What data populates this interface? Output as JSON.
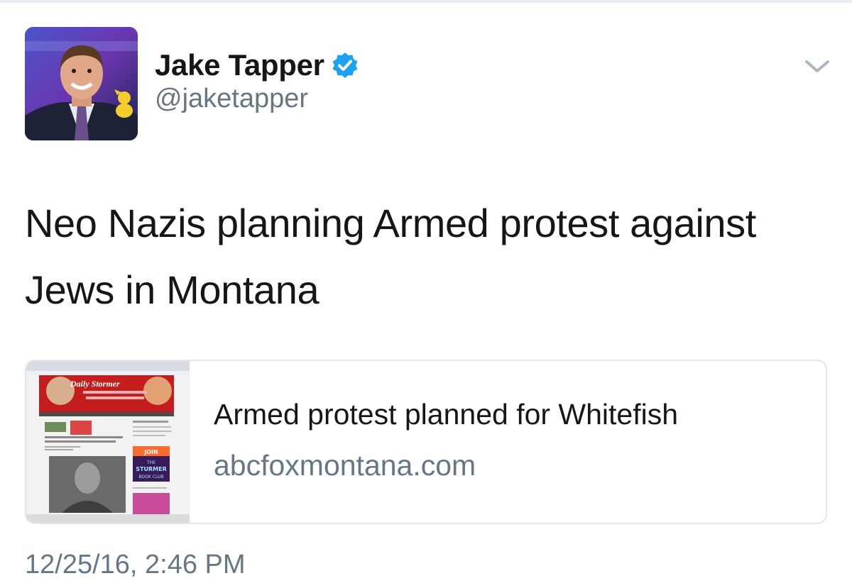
{
  "author": {
    "display_name": "Jake Tapper",
    "handle": "@jaketapper",
    "verified": true,
    "verified_color": "#1da1f2",
    "avatar_icon": "profile-photo"
  },
  "tweet": {
    "text": "Neo Nazis planning Armed protest against Jews in Montana",
    "timestamp": "12/25/16, 2:46 PM"
  },
  "link_card": {
    "title": "Armed protest planned for Whitefish",
    "domain": "abcfoxmontana.com",
    "thumbnail_icon": "website-screenshot-thumbnail",
    "thumbnail_text": {
      "site_name": "Daily Stormer",
      "book_club_join": "JOIN",
      "book_club_the": "THE",
      "book_club_name": "STURMER",
      "book_club_sub": "BOOK CLUB"
    }
  },
  "menu": {
    "icon": "chevron-down-icon"
  },
  "colors": {
    "text": "#14171a",
    "secondary": "#657786",
    "border": "#e1e8ed"
  }
}
